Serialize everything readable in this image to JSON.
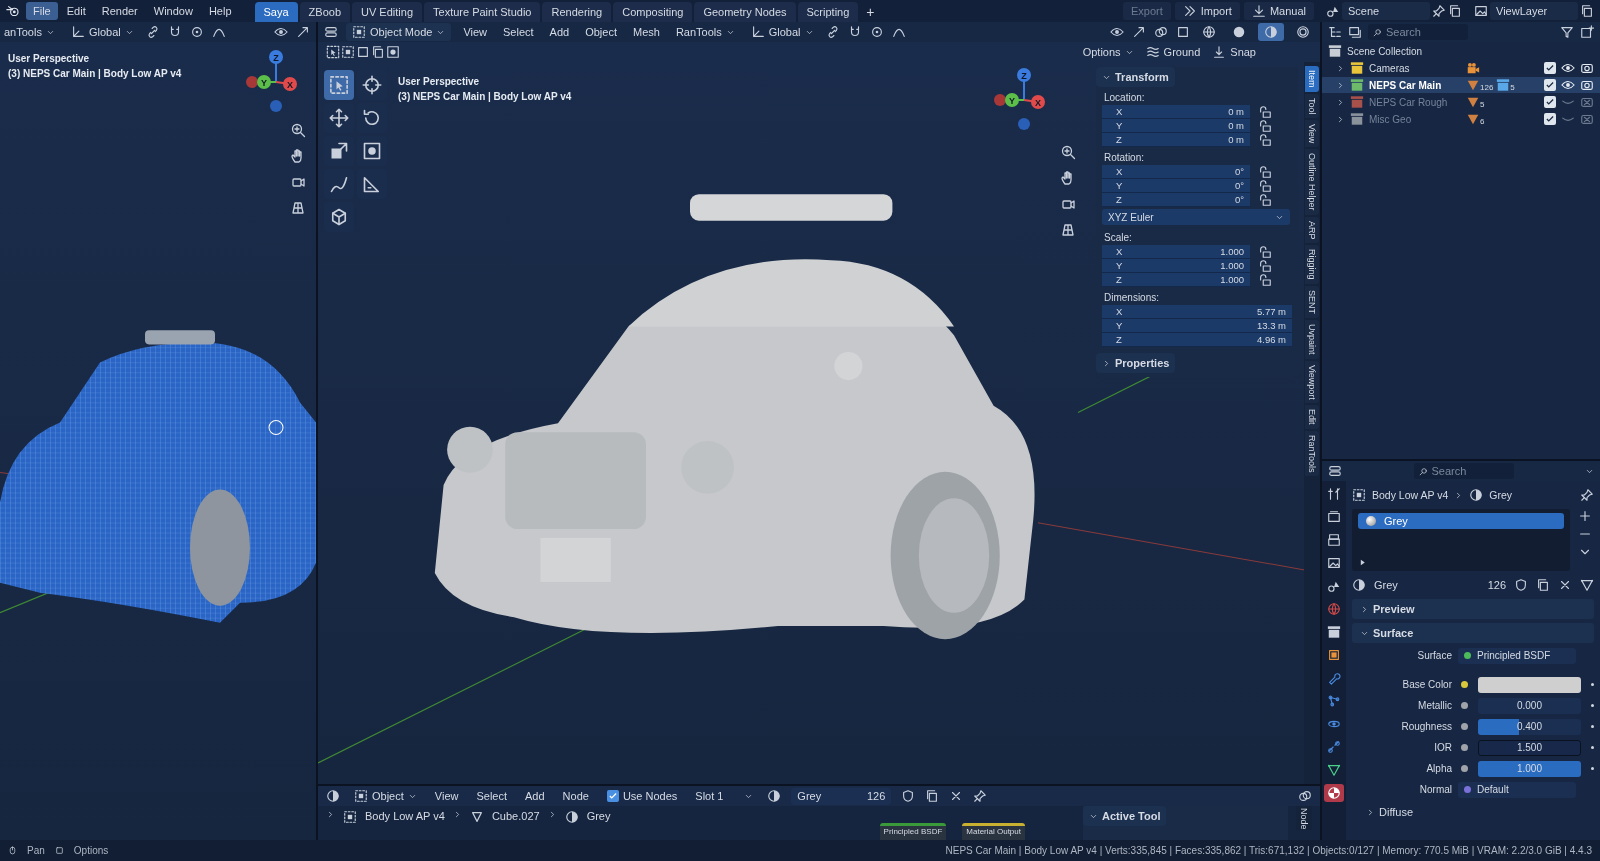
{
  "menu": [
    {
      "label": "File",
      "selected": true
    },
    {
      "label": "Edit",
      "selected": false
    },
    {
      "label": "Render",
      "selected": false
    },
    {
      "label": "Window",
      "selected": false
    },
    {
      "label": "Help",
      "selected": false
    }
  ],
  "workspaces": [
    {
      "label": "Saya",
      "selected": true
    },
    {
      "label": "ZBoob",
      "selected": false
    },
    {
      "label": "UV Editing",
      "selected": false
    },
    {
      "label": "Texture Paint Studio",
      "selected": false
    },
    {
      "label": "Rendering",
      "selected": false
    },
    {
      "label": "Compositing",
      "selected": false
    },
    {
      "label": "Geometry Nodes",
      "selected": false
    },
    {
      "label": "Scripting",
      "selected": false
    }
  ],
  "add_workspace": "+",
  "top_buttons": [
    {
      "kind": "export",
      "label": "Export",
      "disabled": true
    },
    {
      "kind": "import",
      "label": "Import",
      "disabled": false
    },
    {
      "kind": "manual",
      "label": "Manual",
      "disabled": false
    }
  ],
  "scene": "Scene",
  "view_layer": "ViewLayer",
  "left_viewport": {
    "pie_menu": "anTools",
    "orientation": "Global",
    "overlay": [
      "User Perspective",
      "(3) NEPS Car Main | Body Low AP v4"
    ],
    "gizmo": [
      "Z",
      "Y",
      "X"
    ]
  },
  "viewport": {
    "mode": "Object Mode",
    "menus": [
      "View",
      "Select",
      "Add",
      "Object",
      "Mesh",
      "RanTools"
    ],
    "orientation": "Global",
    "shading": [
      {
        "kind": "wireframe",
        "selected": false
      },
      {
        "kind": "solid",
        "selected": false
      },
      {
        "kind": "material",
        "selected": true
      },
      {
        "kind": "rendered",
        "selected": false
      }
    ],
    "options": "Options",
    "ground": "Ground",
    "snap": "Snap",
    "overlay": [
      "User Perspective",
      "(3) NEPS Car Main | Body Low AP v4"
    ],
    "gizmo": [
      "Z",
      "Y",
      "X"
    ],
    "tools": [
      {
        "kind": "select",
        "selected": true
      },
      {
        "kind": "cursor",
        "selected": false
      },
      {
        "kind": "move",
        "selected": false
      },
      {
        "kind": "rotate",
        "selected": false
      },
      {
        "kind": "scale",
        "selected": false
      },
      {
        "kind": "transform",
        "selected": false
      },
      {
        "kind": "annotate",
        "selected": false
      },
      {
        "kind": "measure",
        "selected": false
      },
      {
        "kind": "add_cube",
        "selected": false
      }
    ]
  },
  "n_panel": {
    "title": "Transform",
    "expanded": true,
    "sections": [
      {
        "kind": "group",
        "label": "Location:",
        "fields": [
          {
            "axis": "X",
            "value": "0 m",
            "locked": false
          },
          {
            "axis": "Y",
            "value": "0 m",
            "locked": false
          },
          {
            "axis": "Z",
            "value": "0 m",
            "locked": false
          }
        ]
      },
      {
        "kind": "group",
        "label": "Rotation:",
        "fields": [
          {
            "axis": "X",
            "value": "0°",
            "locked": false
          },
          {
            "axis": "Y",
            "value": "0°",
            "locked": false
          },
          {
            "axis": "Z",
            "value": "0°",
            "locked": false
          }
        ]
      },
      {
        "kind": "dropdown",
        "value": "XYZ Euler"
      },
      {
        "kind": "group",
        "label": "Scale:",
        "fields": [
          {
            "axis": "X",
            "value": "1.000",
            "locked": false
          },
          {
            "axis": "Y",
            "value": "1.000",
            "locked": false
          },
          {
            "axis": "Z",
            "value": "1.000",
            "locked": false
          }
        ]
      },
      {
        "kind": "group",
        "label": "Dimensions:",
        "fields": [
          {
            "axis": "X",
            "value": "5.77 m"
          },
          {
            "axis": "Y",
            "value": "13.3 m"
          },
          {
            "axis": "Z",
            "value": "4.96 m"
          }
        ]
      }
    ],
    "properties": {
      "title": "Properties",
      "expanded": false
    },
    "tabs": [
      {
        "label": "Item",
        "selected": true
      },
      {
        "label": "Tool",
        "selected": false
      },
      {
        "label": "View",
        "selected": false
      },
      {
        "label": "Outline Helper",
        "selected": false
      },
      {
        "label": "ARP",
        "selected": false
      },
      {
        "label": "Rigging",
        "selected": false
      },
      {
        "label": "SENT",
        "selected": false
      },
      {
        "label": "Uvpaint",
        "selected": false
      },
      {
        "label": "Viewport",
        "selected": false
      },
      {
        "label": "Edit",
        "selected": false
      },
      {
        "label": "RanTools",
        "selected": false
      }
    ]
  },
  "outliner": {
    "search": {
      "placeholder": "Search"
    },
    "root": "Scene Collection",
    "collections": [
      {
        "name": "Cameras",
        "color": "#e8c53a",
        "selected": false,
        "checked": true,
        "visible": true,
        "renderable": true,
        "contents": [
          {
            "kind": "camera"
          }
        ]
      },
      {
        "name": "NEPS Car Main",
        "color": "#6dbb6a",
        "selected": true,
        "checked": true,
        "visible": true,
        "renderable": true,
        "contents": [
          {
            "kind": "mesh",
            "count": "126"
          },
          {
            "kind": "collection",
            "count": "5"
          }
        ]
      },
      {
        "name": "NEPS Car Rough",
        "color": "#a8504a",
        "selected": false,
        "checked": true,
        "visible": false,
        "renderable": false,
        "contents": [
          {
            "kind": "mesh",
            "count": "5"
          }
        ]
      },
      {
        "name": "Misc Geo",
        "color": "#8a929c",
        "selected": false,
        "checked": true,
        "visible": false,
        "renderable": false,
        "contents": [
          {
            "kind": "mesh",
            "count": "6"
          }
        ]
      }
    ]
  },
  "properties": {
    "search": {
      "placeholder": "Search"
    },
    "breadcrumb": [
      "Body Low AP v4",
      "Grey"
    ],
    "tabs": [
      {
        "kind": "tool",
        "selected": false
      },
      {
        "kind": "render",
        "selected": false
      },
      {
        "kind": "output",
        "selected": false
      },
      {
        "kind": "view_layer",
        "selected": false
      },
      {
        "kind": "scene",
        "selected": false
      },
      {
        "kind": "world",
        "selected": false
      },
      {
        "kind": "collection",
        "selected": false
      },
      {
        "kind": "object",
        "selected": false
      },
      {
        "kind": "modifiers",
        "selected": false
      },
      {
        "kind": "particles",
        "selected": false
      },
      {
        "kind": "physics",
        "selected": false
      },
      {
        "kind": "constraints",
        "selected": false
      },
      {
        "kind": "data",
        "selected": false
      },
      {
        "kind": "material",
        "selected": true
      }
    ],
    "slots": [
      {
        "name": "Grey",
        "selected": true
      }
    ],
    "material": {
      "name": "Grey",
      "users": "126"
    },
    "panels": [
      {
        "title": "Preview",
        "expanded": false
      },
      {
        "title": "Surface",
        "expanded": true
      }
    ],
    "inputs": [
      {
        "kind": "shader",
        "label": "Surface",
        "value": "Principled BSDF",
        "color": "#4cbb5a"
      },
      {
        "kind": "color",
        "label": "Base Color",
        "color": "#d8c83a"
      },
      {
        "kind": "slider",
        "label": "Metallic",
        "color": "#a0a4aa",
        "value": "0.000",
        "level": 0
      },
      {
        "kind": "slider",
        "label": "Roughness",
        "color": "#a0a4aa",
        "value": "0.400",
        "level": 0.4
      },
      {
        "kind": "number",
        "label": "IOR",
        "color": "#a0a4aa",
        "value": "1.500"
      },
      {
        "kind": "slider",
        "label": "Alpha",
        "color": "#a0a4aa",
        "value": "1.000",
        "level": 1
      },
      {
        "kind": "link",
        "label": "Normal",
        "color": "#7a70d8",
        "value": "Default"
      }
    ],
    "subpanel": {
      "title": "Diffuse",
      "expanded": false
    }
  },
  "node_editor": {
    "editor": "Object",
    "menus": [
      "View",
      "Select",
      "Add",
      "Node"
    ],
    "use_nodes": {
      "label": "Use Nodes",
      "checked": true
    },
    "slot": "Slot 1",
    "material": "Grey",
    "users": "126",
    "breadcrumb": [
      "Body Low AP v4",
      "Cube.027",
      "Grey"
    ],
    "nodes": [
      {
        "title": "Principled BSDF",
        "color": "#3a9a3a"
      },
      {
        "title": "Material Output",
        "color": "#c8b030"
      }
    ],
    "side_panel": {
      "title": "Active Tool",
      "expanded": true
    },
    "tab": "Node"
  },
  "status_bar": {
    "hints": [
      {
        "kind": "mouse",
        "label": "Pan"
      },
      {
        "kind": "options",
        "label": "Options"
      }
    ],
    "stats": "NEPS Car Main | Body Low AP v4 | Verts:335,845 | Faces:335,862 | Tris:671,132 | Objects:0/127 | Memory: 770.5 MiB | VRAM: 2.2/3.0 GiB | 4.4.3"
  }
}
